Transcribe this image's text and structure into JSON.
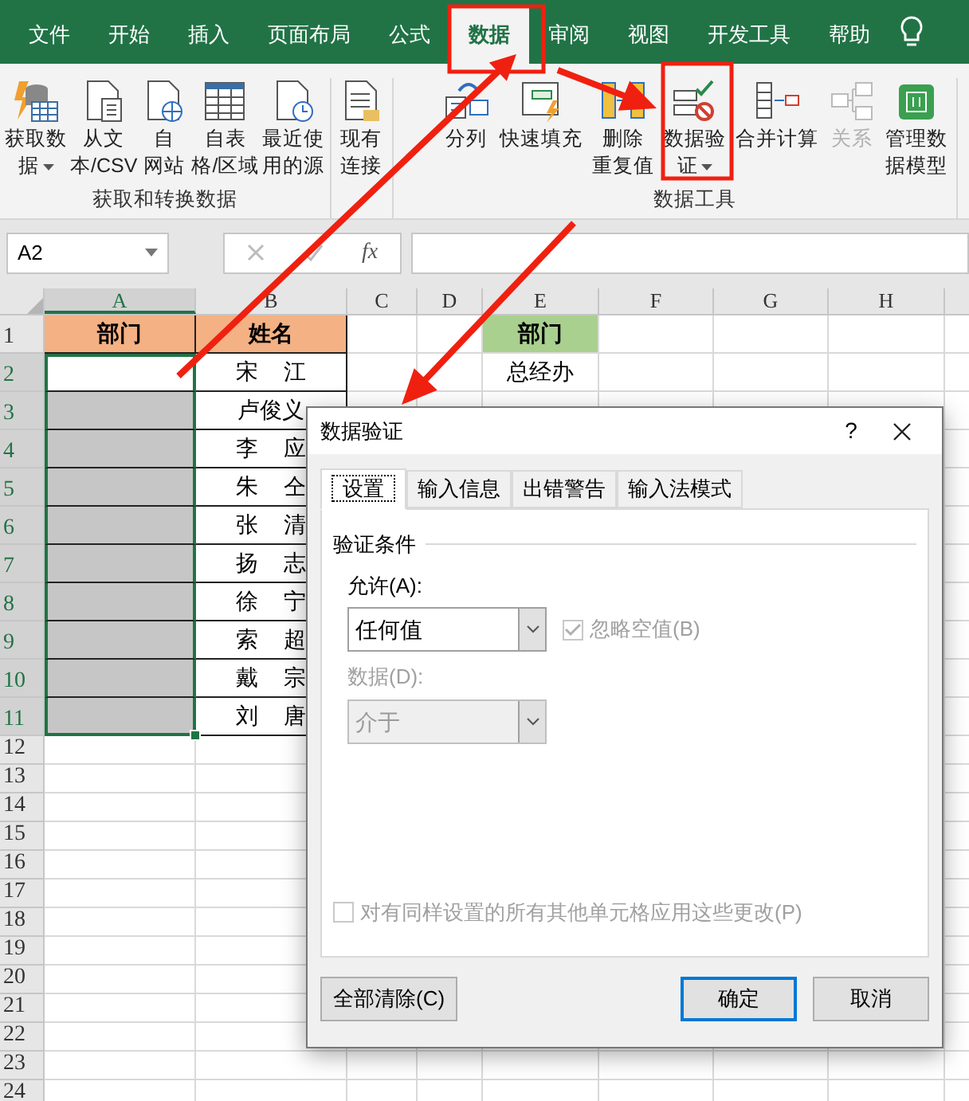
{
  "ribbon_tabs": [
    {
      "label": "文件",
      "selected": false
    },
    {
      "label": "开始",
      "selected": false
    },
    {
      "label": "插入",
      "selected": false
    },
    {
      "label": "页面布局",
      "selected": false
    },
    {
      "label": "公式",
      "selected": false
    },
    {
      "label": "数据",
      "selected": true
    },
    {
      "label": "审阅",
      "selected": false
    },
    {
      "label": "视图",
      "selected": false
    },
    {
      "label": "开发工具",
      "selected": false
    },
    {
      "label": "帮助",
      "selected": false
    }
  ],
  "ribbon_groups": [
    {
      "label": "获取和转换数据",
      "buttons": [
        {
          "lines": [
            "获取数",
            "据"
          ],
          "menu": true,
          "disabled": false
        },
        {
          "lines": [
            "从文",
            "本/CSV"
          ],
          "menu": false,
          "disabled": false
        },
        {
          "lines": [
            "自",
            "网站"
          ],
          "menu": false,
          "disabled": false
        },
        {
          "lines": [
            "自表",
            "格/区域"
          ],
          "menu": false,
          "disabled": false
        },
        {
          "lines": [
            "最近使",
            "用的源"
          ],
          "menu": false,
          "disabled": false
        }
      ]
    },
    {
      "buttons": [
        {
          "lines": [
            "现有",
            "连接"
          ],
          "menu": false,
          "disabled": false
        }
      ]
    },
    {
      "label": "数据工具",
      "buttons": [
        {
          "lines": [
            "分列"
          ],
          "menu": false,
          "disabled": false
        },
        {
          "lines": [
            "快速填充"
          ],
          "menu": false,
          "disabled": false
        },
        {
          "lines": [
            "删除",
            "重复值"
          ],
          "menu": false,
          "disabled": false
        },
        {
          "lines": [
            "数据验",
            "证"
          ],
          "menu": true,
          "disabled": false
        },
        {
          "lines": [
            "合并计算"
          ],
          "menu": false,
          "disabled": false
        },
        {
          "lines": [
            "关系"
          ],
          "menu": false,
          "disabled": true
        },
        {
          "lines": [
            "管理数",
            "据模型"
          ],
          "menu": false,
          "disabled": false
        }
      ]
    }
  ],
  "formula_bar": {
    "name_box": "A2",
    "function_label": "fx"
  },
  "sheet": {
    "columns": [
      {
        "label": "A",
        "selected": true
      },
      {
        "label": "B",
        "selected": false
      },
      {
        "label": "C",
        "selected": false
      },
      {
        "label": "D",
        "selected": false
      },
      {
        "label": "E",
        "selected": false
      },
      {
        "label": "F",
        "selected": false
      },
      {
        "label": "G",
        "selected": false
      },
      {
        "label": "H",
        "selected": false
      }
    ],
    "rows": [
      {
        "number": "1",
        "selected": false,
        "active": false,
        "bordered": true,
        "cells": {
          "A": {
            "text": "部门",
            "kind": "header",
            "color": "#f4b183"
          },
          "B": {
            "text": "姓名",
            "kind": "header",
            "color": "#f4b183"
          },
          "E": {
            "text": "部门",
            "kind": "header",
            "color": "#a9d08e"
          }
        }
      },
      {
        "number": "2",
        "selected": true,
        "active": true,
        "bordered": true,
        "cells": {
          "B": {
            "text": "宋 江",
            "kind": "name"
          },
          "E": {
            "text": "总经办",
            "kind": "text"
          }
        }
      },
      {
        "number": "3",
        "selected": true,
        "active": false,
        "bordered": true,
        "cells": {
          "B": {
            "text": "卢俊义",
            "kind": "name"
          }
        }
      },
      {
        "number": "4",
        "selected": true,
        "active": false,
        "bordered": true,
        "cells": {
          "B": {
            "text": "李 应",
            "kind": "name"
          }
        }
      },
      {
        "number": "5",
        "selected": true,
        "active": false,
        "bordered": true,
        "cells": {
          "B": {
            "text": "朱 仝",
            "kind": "name"
          }
        }
      },
      {
        "number": "6",
        "selected": true,
        "active": false,
        "bordered": true,
        "cells": {
          "B": {
            "text": "张 清",
            "kind": "name"
          }
        }
      },
      {
        "number": "7",
        "selected": true,
        "active": false,
        "bordered": true,
        "cells": {
          "B": {
            "text": "扬 志",
            "kind": "name"
          }
        }
      },
      {
        "number": "8",
        "selected": true,
        "active": false,
        "bordered": true,
        "cells": {
          "B": {
            "text": "徐 宁",
            "kind": "name"
          }
        }
      },
      {
        "number": "9",
        "selected": true,
        "active": false,
        "bordered": true,
        "cells": {
          "B": {
            "text": "索 超",
            "kind": "name"
          }
        }
      },
      {
        "number": "10",
        "selected": true,
        "active": false,
        "bordered": true,
        "cells": {
          "B": {
            "text": "戴 宗",
            "kind": "name"
          }
        }
      },
      {
        "number": "11",
        "selected": true,
        "active": false,
        "bordered": true,
        "cells": {
          "B": {
            "text": "刘 唐",
            "kind": "name"
          }
        }
      },
      {
        "number": "12",
        "selected": false,
        "active": false,
        "bordered": false
      },
      {
        "number": "13",
        "selected": false,
        "active": false,
        "bordered": false
      },
      {
        "number": "14",
        "selected": false,
        "active": false,
        "bordered": false
      },
      {
        "number": "15",
        "selected": false,
        "active": false,
        "bordered": false
      },
      {
        "number": "16",
        "selected": false,
        "active": false,
        "bordered": false
      },
      {
        "number": "17",
        "selected": false,
        "active": false,
        "bordered": false
      },
      {
        "number": "18",
        "selected": false,
        "active": false,
        "bordered": false
      },
      {
        "number": "19",
        "selected": false,
        "active": false,
        "bordered": false
      },
      {
        "number": "20",
        "selected": false,
        "active": false,
        "bordered": false
      },
      {
        "number": "21",
        "selected": false,
        "active": false,
        "bordered": false
      },
      {
        "number": "22",
        "selected": false,
        "active": false,
        "bordered": false
      },
      {
        "number": "23",
        "selected": false,
        "active": false,
        "bordered": false
      },
      {
        "number": "24",
        "selected": false,
        "active": false,
        "bordered": false
      }
    ]
  },
  "dialog": {
    "title": "数据验证",
    "help": "?",
    "tabs": [
      {
        "label": "设置",
        "selected": true
      },
      {
        "label": "输入信息",
        "selected": false
      },
      {
        "label": "出错警告",
        "selected": false
      },
      {
        "label": "输入法模式",
        "selected": false
      }
    ],
    "section": "验证条件",
    "allow": {
      "label": "允许(A):",
      "value": "任何值",
      "disabled": false
    },
    "ignore_blank": {
      "label": "忽略空值(B)",
      "checked": true,
      "disabled": true
    },
    "data": {
      "label": "数据(D):",
      "value": "介于",
      "disabled": true
    },
    "apply_all": {
      "label": "对有同样设置的所有其他单元格应用这些更改(P)",
      "checked": false,
      "disabled": true
    },
    "buttons": [
      {
        "label": "全部清除(C)",
        "default": false
      },
      {
        "label": "确定",
        "default": true
      },
      {
        "label": "取消",
        "default": false
      }
    ]
  }
}
